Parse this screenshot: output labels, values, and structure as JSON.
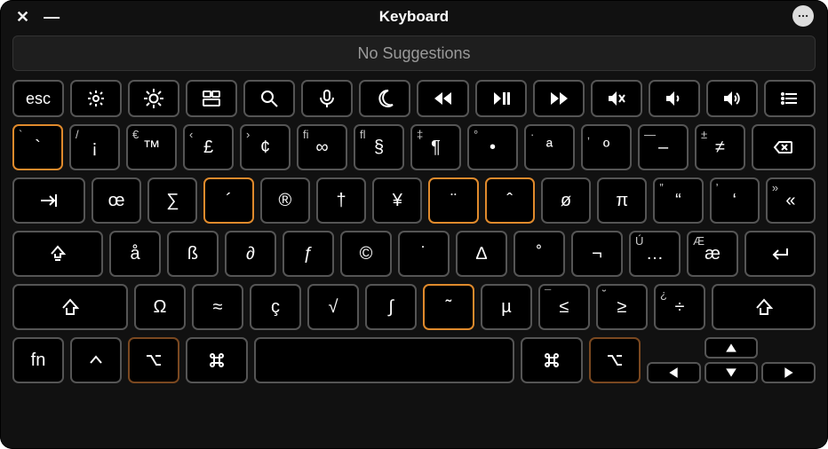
{
  "window": {
    "title": "Keyboard"
  },
  "suggestions": {
    "text": "No Suggestions"
  },
  "function_row": {
    "esc": "esc",
    "items": [
      "brightness-down",
      "brightness-up",
      "mission-control",
      "search",
      "dictation",
      "dnd",
      "rewind",
      "play-pause",
      "fast-forward",
      "mute",
      "volume-down",
      "volume-up",
      "list"
    ]
  },
  "row2": {
    "keys": [
      {
        "main": "`",
        "corner": "`",
        "name": "grave",
        "hl": "orange"
      },
      {
        "main": "¡",
        "corner": "/",
        "name": "inverted-exclamation"
      },
      {
        "main": "™",
        "corner": "€",
        "name": "trademark"
      },
      {
        "main": "£",
        "corner": "‹",
        "name": "pound"
      },
      {
        "main": "¢",
        "corner": "›",
        "name": "cent"
      },
      {
        "main": "∞",
        "corner": "fi",
        "name": "infinity"
      },
      {
        "main": "§",
        "corner": "fl",
        "name": "section"
      },
      {
        "main": "¶",
        "corner": "‡",
        "name": "pilcrow"
      },
      {
        "main": "•",
        "corner": "°",
        "name": "bullet"
      },
      {
        "main": "ª",
        "corner": "·",
        "name": "ordinal-a"
      },
      {
        "main": "º",
        "corner": "‚",
        "name": "ordinal-o"
      },
      {
        "main": "–",
        "corner": "—",
        "name": "en-dash"
      },
      {
        "main": "≠",
        "corner": "±",
        "name": "not-equal"
      }
    ],
    "delete_name": "delete"
  },
  "row3": {
    "tab_name": "tab",
    "keys": [
      {
        "main": "œ",
        "name": "oe"
      },
      {
        "main": "∑",
        "name": "sigma-sum"
      },
      {
        "main": "´",
        "name": "acute",
        "hl": "orange"
      },
      {
        "main": "®",
        "name": "registered"
      },
      {
        "main": "†",
        "name": "dagger"
      },
      {
        "main": "¥",
        "name": "yen"
      },
      {
        "main": "¨",
        "name": "diaeresis",
        "hl": "orange"
      },
      {
        "main": "ˆ",
        "name": "circumflex",
        "hl": "orange"
      },
      {
        "main": "ø",
        "name": "o-stroke"
      },
      {
        "main": "π",
        "name": "pi"
      },
      {
        "main": "“",
        "corner": "”",
        "name": "left-double-quote"
      },
      {
        "main": "‘",
        "corner": "’",
        "name": "left-single-quote"
      },
      {
        "main": "«",
        "corner": "»",
        "name": "guillemet"
      }
    ]
  },
  "row4": {
    "caps_name": "caps-lock",
    "keys": [
      {
        "main": "å",
        "name": "a-ring"
      },
      {
        "main": "ß",
        "name": "sharp-s"
      },
      {
        "main": "∂",
        "name": "partial"
      },
      {
        "main": "ƒ",
        "name": "florin"
      },
      {
        "main": "©",
        "name": "copyright"
      },
      {
        "main": "˙",
        "name": "dot-above"
      },
      {
        "main": "∆",
        "name": "delta"
      },
      {
        "main": "˚",
        "name": "ring-above"
      },
      {
        "main": "¬",
        "name": "not-sign"
      },
      {
        "main": "…",
        "corner": "Ú",
        "name": "ellipsis"
      },
      {
        "main": "æ",
        "corner": "Æ",
        "name": "ae"
      }
    ],
    "return_name": "return"
  },
  "row5": {
    "shift_left_name": "shift-left",
    "keys": [
      {
        "main": "Ω",
        "name": "omega"
      },
      {
        "main": "≈",
        "name": "approx"
      },
      {
        "main": "ç",
        "name": "c-cedilla"
      },
      {
        "main": "√",
        "name": "sqrt"
      },
      {
        "main": "∫",
        "name": "integral"
      },
      {
        "main": "˜",
        "name": "tilde",
        "hl": "orange"
      },
      {
        "main": "µ",
        "name": "mu"
      },
      {
        "main": "≤",
        "corner": "¯",
        "name": "le"
      },
      {
        "main": "≥",
        "corner": "˘",
        "name": "ge"
      },
      {
        "main": "÷",
        "corner": "¿",
        "name": "divide"
      }
    ],
    "shift_right_name": "shift-right"
  },
  "row6": {
    "fn": "fn",
    "control_name": "control",
    "option_left_name": "option-left",
    "command_left_name": "command-left",
    "space_name": "spacebar",
    "command_right_name": "command-right",
    "option_right_name": "option-right",
    "arrows": {
      "up": "up",
      "down": "down",
      "left": "left",
      "right": "right"
    }
  },
  "icons": {
    "brightness-down": "sun-small",
    "brightness-up": "sun-large",
    "mission-control": "mission",
    "search": "magnifier",
    "dictation": "mic",
    "dnd": "moon",
    "rewind": "rew",
    "play-pause": "playpause",
    "fast-forward": "ff",
    "mute": "mute",
    "volume-down": "vol-lo",
    "volume-up": "vol-hi",
    "list": "list"
  }
}
